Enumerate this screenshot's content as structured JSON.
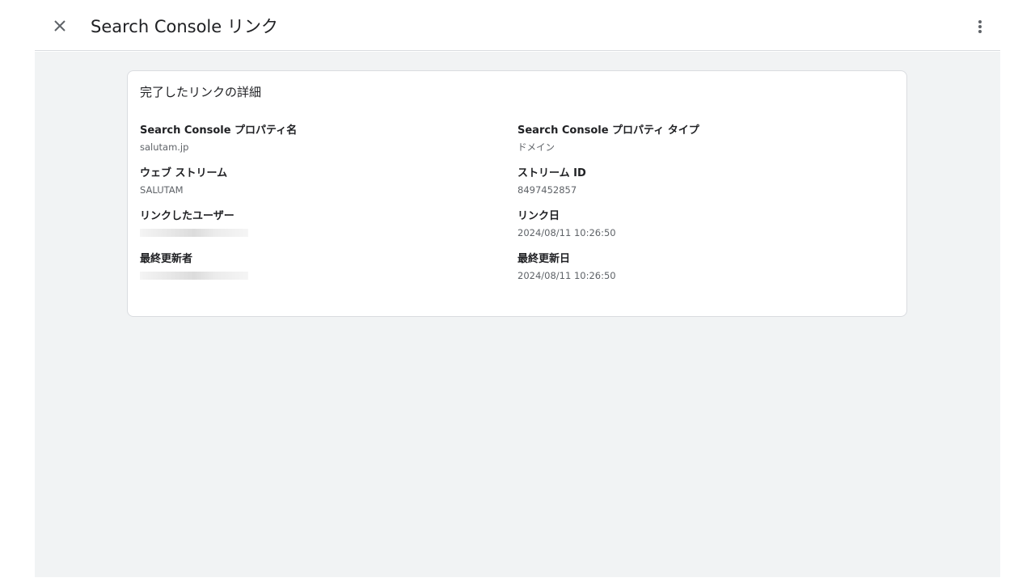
{
  "header": {
    "title": "Search Console リンク",
    "close_icon": "close-icon",
    "more_icon": "more-vert-icon"
  },
  "card": {
    "title": "完了したリンクの詳細",
    "fields": {
      "property_name": {
        "label": "Search Console プロパティ名",
        "value": "salutam.jp"
      },
      "property_type": {
        "label": "Search Console プロパティ タイプ",
        "value": "ドメイン"
      },
      "web_stream": {
        "label": "ウェブ ストリーム",
        "value": "SALUTAM"
      },
      "stream_id": {
        "label": "ストリーム ID",
        "value": "8497452857"
      },
      "linked_user": {
        "label": "リンクしたユーザー",
        "value": ""
      },
      "link_date": {
        "label": "リンク日",
        "value": "2024/08/11 10:26:50"
      },
      "last_updated_by": {
        "label": "最終更新者",
        "value": ""
      },
      "last_updated": {
        "label": "最終更新日",
        "value": "2024/08/11 10:26:50"
      }
    }
  },
  "colors": {
    "background": "#f1f3f4",
    "card": "#ffffff",
    "border": "#dadce0",
    "text_primary": "#202124",
    "text_secondary": "#5f6368",
    "icon": "#5f6368"
  }
}
